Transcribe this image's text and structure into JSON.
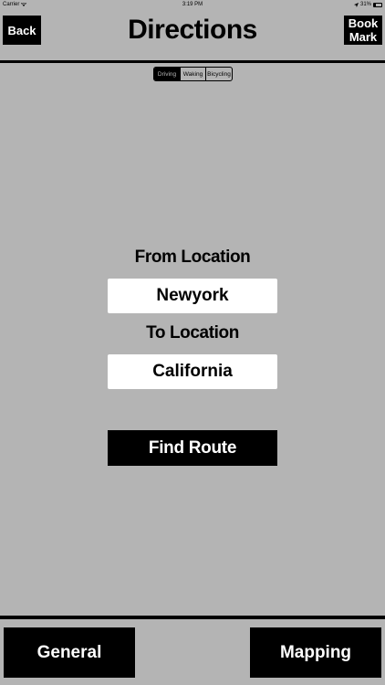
{
  "status_bar": {
    "carrier": "Carrier",
    "time": "3:19 PM",
    "battery": "31%",
    "battery_level": 0.31
  },
  "nav": {
    "back_label": "Back",
    "title": "Directions",
    "bookmark_label": "Book\nMark"
  },
  "mode_selector": {
    "options": [
      "Driving",
      "Waking",
      "Bicycling"
    ],
    "selected": "Driving"
  },
  "form": {
    "from_label": "From Location",
    "from_value": "Newyork",
    "to_label": "To Location",
    "to_value": "California",
    "find_route_label": "Find Route"
  },
  "tabs": {
    "general_label": "General",
    "mapping_label": "Mapping"
  },
  "colors": {
    "background": "#b4b4b4",
    "button": "#000000",
    "button_text": "#ffffff",
    "input_bg": "#ffffff"
  }
}
